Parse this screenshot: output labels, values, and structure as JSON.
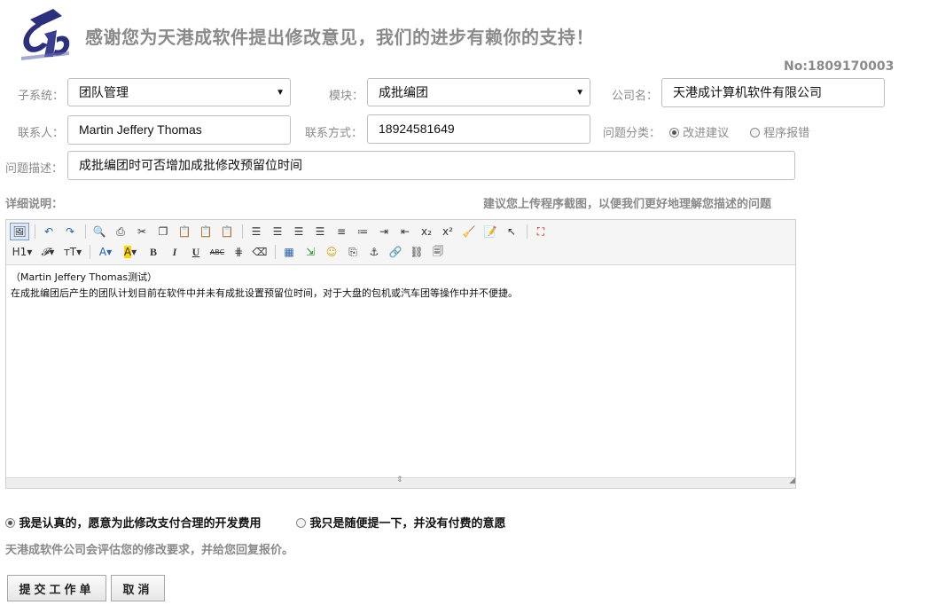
{
  "header": {
    "title": "感谢您为天港成软件提出修改意见，我们的进步有赖你的支持！",
    "doc_no": "No:1809170003"
  },
  "form": {
    "subsystem": {
      "label": "子系统：",
      "value": "团队管理"
    },
    "module": {
      "label": "模块：",
      "value": "成批编团"
    },
    "company": {
      "label": "公司名：",
      "value": "天港成计算机软件有限公司"
    },
    "contact": {
      "label": "联系人：",
      "value": "Martin Jeffery Thomas"
    },
    "contact_info": {
      "label": "联系方式：",
      "value": "18924581649"
    },
    "category": {
      "label": "问题分类：",
      "options": [
        "改进建议",
        "程序报错"
      ],
      "selected": "改进建议"
    },
    "description": {
      "label": "问题描述：",
      "value": "成批编团时可否增加成批修改预留位时间"
    },
    "detail_label": "详细说明：",
    "hint": "建议您上传程序截图，以便我们更好地理解您描述的问题"
  },
  "editor": {
    "toolbar_row1": [
      "source",
      "undo",
      "redo",
      "preview",
      "print",
      "cut",
      "copy",
      "paste",
      "paste-text",
      "paste-word",
      "align-left",
      "align-center",
      "align-right",
      "justify",
      "ordered-list",
      "unordered-list",
      "indent",
      "outdent",
      "subscript",
      "superscript",
      "clear-format",
      "select-all",
      "select",
      "fullscreen"
    ],
    "toolbar_row2_labels": {
      "heading": "H1",
      "font": "𝓕",
      "size": "тT",
      "fontcolor": "A",
      "highlight": "A",
      "bold": "B",
      "italic": "I",
      "underline": "U",
      "strike": "ABC"
    },
    "content_lines": [
      "（Martin Jeffery Thomas测试）",
      "在成批编团后产生的团队计划目前在软件中并未有成批设置预留位时间，对于大盘的包机或汽车团等操作中并不便捷。"
    ]
  },
  "payment": {
    "options": [
      "我是认真的，愿意为此修改支付合理的开发费用",
      "我只是随便提一下，并没有付费的意愿"
    ],
    "selected": 0,
    "note": "天港成软件公司会评估您的修改要求，并给您回复报价。"
  },
  "actions": {
    "submit": "提交工作单",
    "cancel": "取消"
  },
  "colors": {
    "label_gray": "#8a8a8a",
    "border": "#bfbfbf",
    "logo_blue": "#2c2f7a"
  }
}
